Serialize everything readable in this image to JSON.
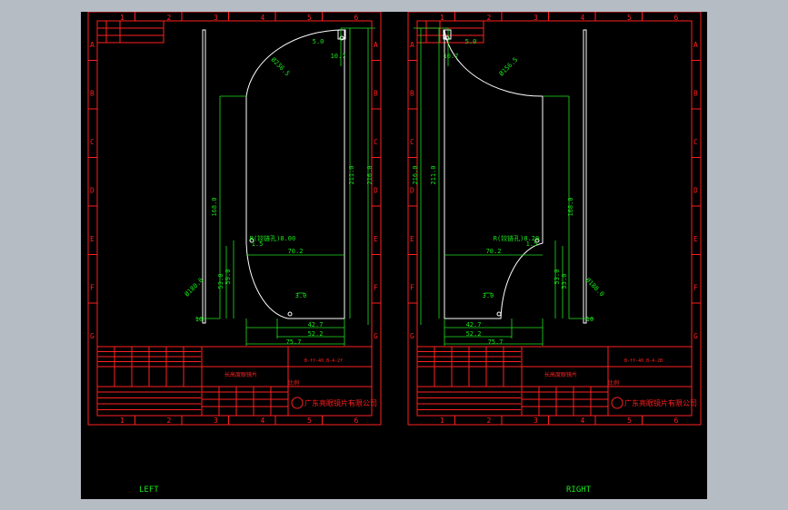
{
  "colors": {
    "frame": "#ff2020",
    "dimension": "#1fe01f",
    "outline": "#ffffff",
    "label": "#19e619",
    "background": "#000000",
    "surround": "#b6bcc4"
  },
  "sheet_letters": [
    "A",
    "B",
    "C",
    "D",
    "E",
    "F",
    "G"
  ],
  "sheet_numbers": [
    "1",
    "2",
    "3",
    "4",
    "5",
    "6"
  ],
  "sheets": [
    {
      "id": "left",
      "caption": "LEFT",
      "dimensions": {
        "top_offset": "5.0",
        "top_width": "10.7",
        "top_radius": "Ø236.5",
        "overall_height_inner": "211.0",
        "overall_height": "216.0",
        "flat_height": "168.0",
        "notch": "R(铰链孔)8.00",
        "notch_small": "1.5",
        "mid_width": "70.2",
        "lower_h1": "59.0",
        "lower_h2": "53.0",
        "bottom_radius": "Ø180.0",
        "small_gap": "3.0",
        "base_w1": "42.7",
        "base_w2": "52.2",
        "base_w3": "75.7",
        "pin_size": "10"
      },
      "title_block": {
        "drawing_number": "B-ff-40 B-4-2f",
        "part_name": "长高度眼镜片",
        "company": "广东亮眼镜片有限公司",
        "sheet_label": "比例"
      }
    },
    {
      "id": "right",
      "caption": "RIGHT",
      "dimensions": {
        "top_offset": "5.0",
        "top_width": "10.7",
        "top_radius": "Ø156.5",
        "overall_height_inner": "211.0",
        "overall_height": "216.0",
        "flat_height": "168.0",
        "notch": "R(铰链孔)8.20",
        "notch_small": "1.5",
        "mid_width": "70.2",
        "lower_h1": "53.0",
        "lower_h2": "53.0",
        "bottom_radius": "Ø180.0",
        "small_gap": "3.0",
        "base_w1": "42.7",
        "base_w2": "52.2",
        "base_w3": "75.7",
        "pin_size": "10"
      },
      "title_block": {
        "drawing_number": "B-ff-40 B-4-2B",
        "part_name": "长高度眼镜片",
        "company": "广东亮眼镜片有限公司",
        "sheet_label": "比例"
      }
    }
  ]
}
